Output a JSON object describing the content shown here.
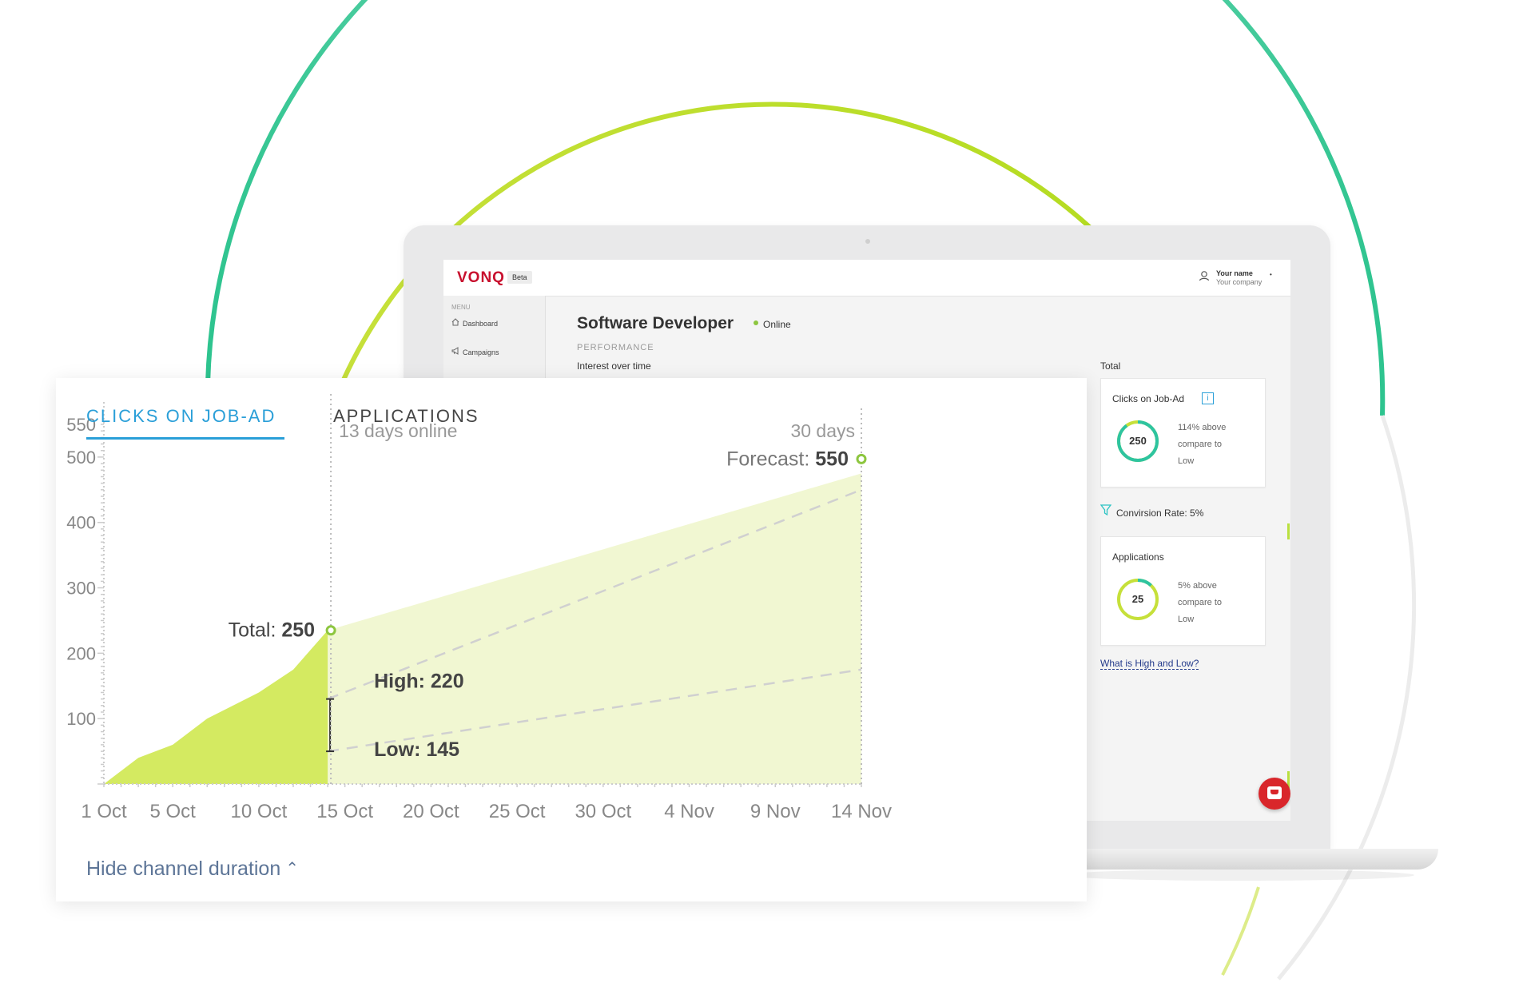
{
  "colors": {
    "accent_blue": "#2a9fd8",
    "lime_area": "#d4ea61",
    "forecast_area": "#f1f7d2",
    "brand_red": "#c8102e",
    "ring_green": "#2ec4a0",
    "ring_lime": "#c6e03a",
    "link_slate": "#5d7597"
  },
  "app": {
    "logo": "VONQ",
    "badge": "Beta",
    "user_name": "Your name",
    "user_company": "Your company",
    "user_caret": "•",
    "user_icon": "user-icon"
  },
  "sidebar": {
    "menu_label": "MENU",
    "items": [
      {
        "label": "Dashboard",
        "icon": "home-icon"
      },
      {
        "label": "Campaigns",
        "icon": "megaphone-icon"
      }
    ]
  },
  "page": {
    "title": "Software Developer",
    "status": "Online",
    "section": "PERFORMANCE",
    "subtitle": "Interest over time",
    "total_label": "Total"
  },
  "cards": [
    {
      "title": "Clicks on Job-Ad",
      "value": "250",
      "line1": "114% above",
      "line2": "compare to",
      "line3": "Low",
      "ring_fraction": 0.9,
      "has_info": true,
      "info_glyph": "i"
    },
    {
      "title": "Applications",
      "value": "25",
      "line1": "5% above",
      "line2": "compare to",
      "line3": "Low",
      "ring_fraction": 0.12,
      "has_info": false
    }
  ],
  "conversion": {
    "text": "Convirsion Rate: 5%",
    "icon": "filter-icon"
  },
  "help_link": "What is High and Low?",
  "chart_card": {
    "tabs": [
      "CLICKS ON JOB-AD",
      "APPLICATIONS"
    ],
    "active_tab": 0,
    "hide_link": "Hide channel duration",
    "hide_icon": "double-chevron-up-icon",
    "hide_glyph": "⌃"
  },
  "chart_data": {
    "type": "area",
    "y_ticks": [
      100,
      200,
      300,
      400,
      500,
      550
    ],
    "ylim": [
      0,
      550
    ],
    "xlabels": [
      "1 Oct",
      "5 Oct",
      "10 Oct",
      "15 Oct",
      "20 Oct",
      "25 Oct",
      "30 Oct",
      "4 Nov",
      "9 Nov",
      "14 Nov"
    ],
    "start_date": "1 Oct",
    "end_date": "14 Nov",
    "grid": false,
    "annotations": {
      "online_label": "13 days online",
      "end_label": "30 days",
      "total_label": "Total:",
      "total_value": "250",
      "forecast_label": "Forecast:",
      "forecast_value": "550",
      "high_label": "High:",
      "high_value": "220",
      "low_label": "Low:",
      "low_value": "145"
    },
    "series": [
      {
        "name": "Total",
        "points": [
          {
            "x": "1 Oct",
            "y": 0
          },
          {
            "x": "3 Oct",
            "y": 40
          },
          {
            "x": "5 Oct",
            "y": 60
          },
          {
            "x": "7 Oct",
            "y": 100
          },
          {
            "x": "10 Oct",
            "y": 140
          },
          {
            "x": "12 Oct",
            "y": 175
          },
          {
            "x": "14 Oct",
            "y": 235
          }
        ]
      },
      {
        "name": "Forecast",
        "points": [
          {
            "x": "14 Oct",
            "y": 235
          },
          {
            "x": "14 Nov",
            "y": 475
          }
        ]
      },
      {
        "name": "High",
        "points": [
          {
            "x": "14 Oct",
            "y": 130
          },
          {
            "x": "14 Nov",
            "y": 450
          }
        ]
      },
      {
        "name": "Low",
        "points": [
          {
            "x": "14 Oct",
            "y": 50
          },
          {
            "x": "14 Nov",
            "y": 175
          }
        ]
      }
    ]
  }
}
